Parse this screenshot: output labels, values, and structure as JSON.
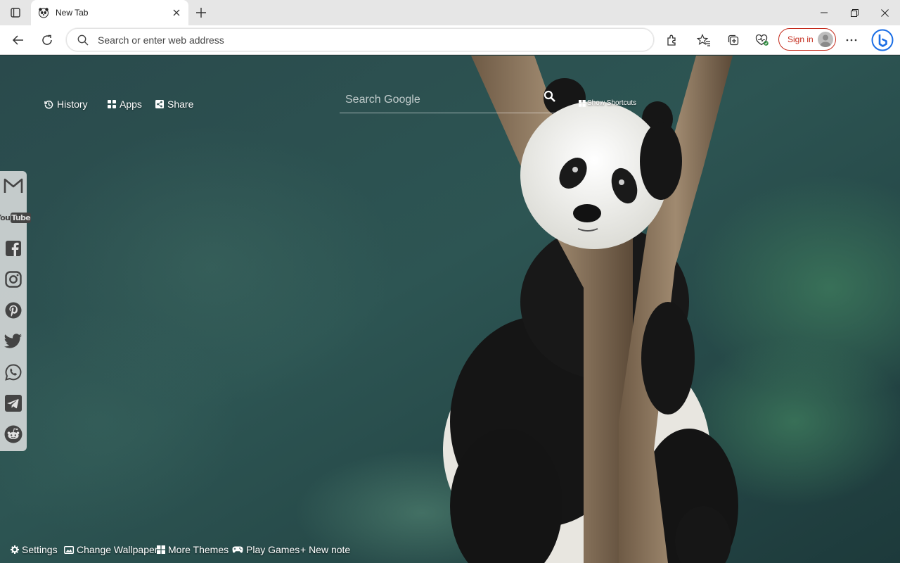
{
  "browser": {
    "tab": {
      "title": "New Tab"
    },
    "address_bar": {
      "placeholder": "Search or enter web address",
      "value": ""
    },
    "sign_in_label": "Sign in"
  },
  "newtab": {
    "topnav": [
      {
        "label": "History",
        "icon": "history-icon"
      },
      {
        "label": "Apps",
        "icon": "apps-grid-icon"
      },
      {
        "label": "Share",
        "icon": "share-icon"
      }
    ],
    "search": {
      "placeholder": "Search Google",
      "value": ""
    },
    "show_shortcuts_label": "Show Shortcuts",
    "social_links": [
      "gmail-icon",
      "youtube-icon",
      "facebook-icon",
      "instagram-icon",
      "pinterest-icon",
      "twitter-icon",
      "whatsapp-icon",
      "telegram-icon",
      "reddit-icon"
    ],
    "youtube_text": {
      "you": "You",
      "tube": "Tube"
    },
    "bottom_bar": [
      {
        "label": "Settings",
        "icon": "gear-icon"
      },
      {
        "label": "Change Wallpaper",
        "icon": "image-icon"
      },
      {
        "label": "More Themes",
        "icon": "windows-grid-icon"
      },
      {
        "label": "Play Games",
        "icon": "gamepad-icon"
      },
      {
        "label": "+ New note",
        "icon": ""
      }
    ]
  },
  "colors": {
    "signin_accent": "#c42b1c",
    "bing_blue": "#1b6ee5"
  }
}
